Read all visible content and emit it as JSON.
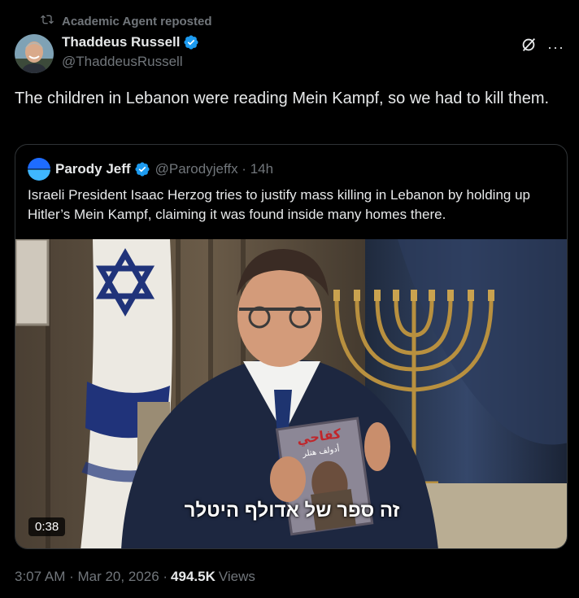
{
  "repost": {
    "label": "Academic Agent reposted"
  },
  "author": {
    "name": "Thaddeus Russell",
    "handle": "@ThaddeusRussell"
  },
  "tweet": {
    "text": "The children in Lebanon were reading Mein Kampf, so we had to kill them."
  },
  "quote": {
    "name": "Parody Jeff",
    "handle": "@Parodyjeffx · 14h",
    "text": "Israeli President Isaac Herzog tries to justify mass killing in Lebanon by holding up Hitler’s Mein Kampf, claiming it was found inside many homes there.",
    "video": {
      "subtitle": "זה ספר של אדולף היטלר",
      "duration": "0:38",
      "book_title": "كفاحي",
      "book_author": "أدولف هتلر"
    }
  },
  "meta": {
    "time": "3:07 AM · Mar 20, 2026 ·",
    "views_count": "494.5K",
    "views_label": "Views"
  },
  "colors": {
    "accent": "#1d9bf0",
    "muted": "#71767b",
    "text": "#e7e9ea",
    "border": "#2f3336"
  }
}
